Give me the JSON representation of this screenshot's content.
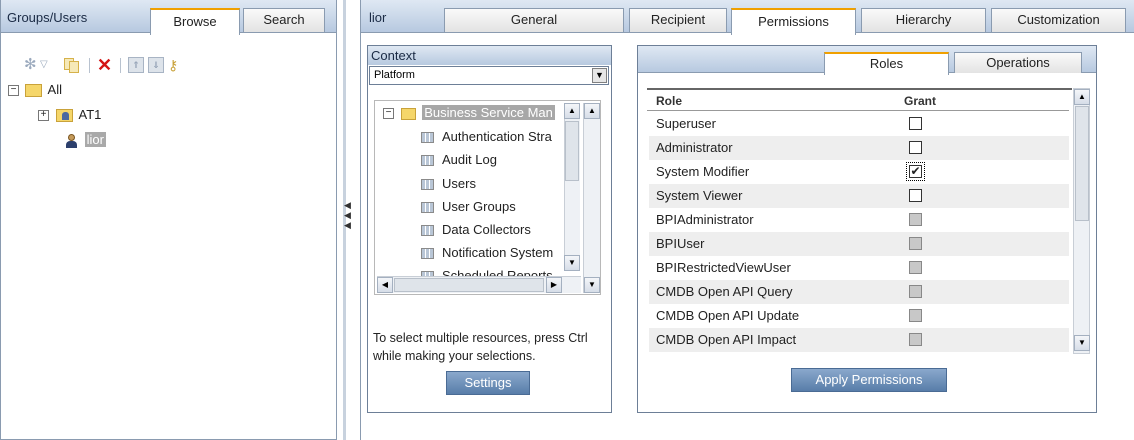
{
  "left_panel": {
    "title": "Groups/Users",
    "tabs": [
      {
        "label": "Browse",
        "active": true
      },
      {
        "label": "Search",
        "active": false
      }
    ],
    "toolbar_icons": [
      "settings-dropdown-icon",
      "copy-icon",
      "delete-icon",
      "move-up-icon",
      "move-down-icon",
      "keys-icon"
    ],
    "tree": [
      {
        "label": "All",
        "icon": "folder-icon",
        "expander": "−"
      },
      {
        "label": "AT1",
        "icon": "group-icon",
        "expander": "+"
      },
      {
        "label": "lior",
        "icon": "user-icon",
        "selected": true
      }
    ]
  },
  "collapse_arrows": "◀◀◀",
  "right_panel": {
    "title": "lior",
    "tabs": [
      {
        "label": "General",
        "active": false
      },
      {
        "label": "Recipient",
        "active": false
      },
      {
        "label": "Permissions",
        "active": true
      },
      {
        "label": "Hierarchy",
        "active": false
      },
      {
        "label": "Customization",
        "active": false
      }
    ]
  },
  "context": {
    "title": "Context",
    "select_value": "Platform",
    "tree_root": "Business Service Man",
    "tree_items": [
      "Authentication Stra",
      "Audit Log",
      "Users",
      "User Groups",
      "Data Collectors",
      "Notification System",
      "Scheduled Reports"
    ],
    "help_text": "To select multiple resources, press Ctrl while making your selections.",
    "settings_button": "Settings"
  },
  "permissions": {
    "tabs": [
      {
        "label": "Roles",
        "active": true
      },
      {
        "label": "Operations",
        "active": false
      }
    ],
    "col_role": "Role",
    "col_grant": "Grant",
    "roles": [
      {
        "name": "Superuser",
        "checked": false,
        "enabled": true
      },
      {
        "name": "Administrator",
        "checked": false,
        "enabled": true
      },
      {
        "name": "System Modifier",
        "checked": true,
        "enabled": true
      },
      {
        "name": "System Viewer",
        "checked": false,
        "enabled": true
      },
      {
        "name": "BPIAdministrator",
        "checked": false,
        "enabled": false
      },
      {
        "name": "BPIUser",
        "checked": false,
        "enabled": false
      },
      {
        "name": "BPIRestrictedViewUser",
        "checked": false,
        "enabled": false
      },
      {
        "name": "CMDB Open API Query",
        "checked": false,
        "enabled": false
      },
      {
        "name": "CMDB Open API Update",
        "checked": false,
        "enabled": false
      },
      {
        "name": "CMDB Open API Impact",
        "checked": false,
        "enabled": false
      }
    ],
    "apply_button": "Apply Permissions"
  }
}
